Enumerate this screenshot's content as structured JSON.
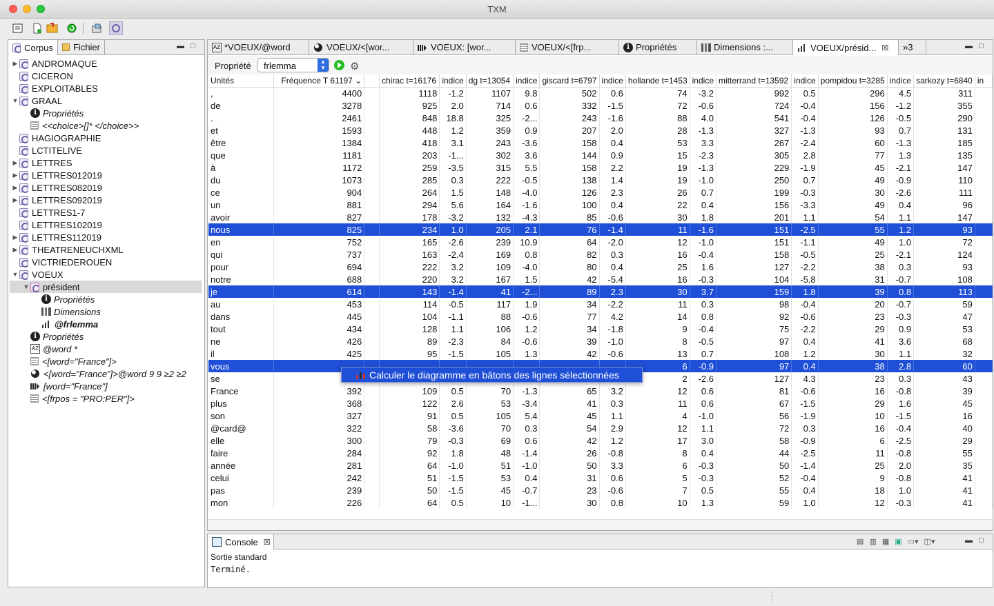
{
  "window": {
    "title": "TXM"
  },
  "colors": {
    "selection": "#1f4fd6",
    "tab_active": "#ffffff"
  },
  "left_panel": {
    "tabs": [
      {
        "label": "Corpus",
        "icon": "corpus-icon"
      },
      {
        "label": "Fichier",
        "icon": "folder-icon"
      }
    ],
    "tree": [
      {
        "label": "ANDROMAQUE",
        "depth": 0,
        "icon": "corpus",
        "expander": "closed"
      },
      {
        "label": "CICERON",
        "depth": 0,
        "icon": "corpus",
        "expander": "none"
      },
      {
        "label": "EXPLOITABLES",
        "depth": 0,
        "icon": "corpus",
        "expander": "none"
      },
      {
        "label": "GRAAL",
        "depth": 0,
        "icon": "corpus",
        "expander": "open"
      },
      {
        "label": "Propriétés",
        "depth": 1,
        "icon": "info",
        "expander": "none",
        "italic": true
      },
      {
        "label": "<<choice>[]* </choice>>",
        "depth": 1,
        "icon": "grid",
        "expander": "none",
        "italic": true
      },
      {
        "label": "HAGIOGRAPHIE",
        "depth": 0,
        "icon": "corpus",
        "expander": "none"
      },
      {
        "label": "LCTITELIVE",
        "depth": 0,
        "icon": "corpus",
        "expander": "none"
      },
      {
        "label": "LETTRES",
        "depth": 0,
        "icon": "corpus",
        "expander": "closed"
      },
      {
        "label": "LETTRES012019",
        "depth": 0,
        "icon": "corpus",
        "expander": "closed"
      },
      {
        "label": "LETTRES082019",
        "depth": 0,
        "icon": "corpus",
        "expander": "closed"
      },
      {
        "label": "LETTRES092019",
        "depth": 0,
        "icon": "corpus",
        "expander": "closed"
      },
      {
        "label": "LETTRES1-7",
        "depth": 0,
        "icon": "corpus",
        "expander": "none"
      },
      {
        "label": "LETTRES102019",
        "depth": 0,
        "icon": "corpus",
        "expander": "none"
      },
      {
        "label": "LETTRES112019",
        "depth": 0,
        "icon": "corpus",
        "expander": "closed"
      },
      {
        "label": "THEATRENEUCHXML",
        "depth": 0,
        "icon": "corpus",
        "expander": "closed"
      },
      {
        "label": "VICTRIEDEROUEN",
        "depth": 0,
        "icon": "corpus",
        "expander": "none"
      },
      {
        "label": "VOEUX",
        "depth": 0,
        "icon": "corpus",
        "expander": "open"
      },
      {
        "label": "président",
        "depth": 1,
        "icon": "partition",
        "expander": "open",
        "selected": true
      },
      {
        "label": "Propriétés",
        "depth": 2,
        "icon": "info",
        "expander": "none",
        "italic": true
      },
      {
        "label": "Dimensions",
        "depth": 2,
        "icon": "barchart",
        "expander": "none",
        "italic": true
      },
      {
        "label": "@frlemma",
        "depth": 2,
        "icon": "specif",
        "expander": "none",
        "italic": true,
        "bold": true
      },
      {
        "label": "Propriétés",
        "depth": 1,
        "icon": "info",
        "expander": "none",
        "italic": true
      },
      {
        "label": "@word *",
        "depth": 1,
        "icon": "az",
        "expander": "none",
        "italic": true
      },
      {
        "label": "<[word=\"France\"]>",
        "depth": 1,
        "icon": "grid",
        "expander": "none",
        "italic": true
      },
      {
        "label": "<[word=\"France\"]>@word 9 9 ≥2 ≥2",
        "depth": 1,
        "icon": "cooc",
        "expander": "none",
        "italic": true
      },
      {
        "label": "[word=\"France\"]",
        "depth": 1,
        "icon": "progression",
        "expander": "none",
        "italic": true
      },
      {
        "label": "<[frpos = \"PRO:PER\"]>",
        "depth": 1,
        "icon": "grid",
        "expander": "none",
        "italic": true
      }
    ]
  },
  "editor": {
    "tabs": [
      {
        "label": "*VOEUX/@word",
        "icon": "az"
      },
      {
        "label": "VOEUX/<[wor...",
        "icon": "cooc"
      },
      {
        "label": "VOEUX: [wor...",
        "icon": "progression"
      },
      {
        "label": "VOEUX/<[frp...",
        "icon": "grid"
      },
      {
        "label": "Propriétés",
        "icon": "info"
      },
      {
        "label": "Dimensions :...",
        "icon": "barchart"
      },
      {
        "label": "VOEUX/présid...",
        "icon": "specif",
        "active": true,
        "closable": true
      }
    ],
    "overflow_label": "»3",
    "property_label": "Propriété",
    "property_value": "frlemma",
    "columns": [
      "Unités",
      "Fréquence T 61197 ⌄",
      "chirac t=16176",
      "indice",
      "dg t=13054",
      "indice",
      "giscard t=6797",
      "indice",
      "hollande t=1453",
      "indice",
      "mitterrand t=13592",
      "indice",
      "pompidou t=3285",
      "indice",
      "sarkozy t=6840",
      "in"
    ],
    "rows": [
      [
        ",",
        "4400",
        "1118",
        "-1.2",
        "1107",
        "9.8",
        "502",
        "0.6",
        "74",
        "-3.2",
        "992",
        "0.5",
        "296",
        "4.5",
        "311"
      ],
      [
        "de",
        "3278",
        "925",
        "2.0",
        "714",
        "0.6",
        "332",
        "-1.5",
        "72",
        "-0.6",
        "724",
        "-0.4",
        "156",
        "-1.2",
        "355"
      ],
      [
        ".",
        "2461",
        "848",
        "18.8",
        "325",
        "-2...",
        "243",
        "-1.6",
        "88",
        "4.0",
        "541",
        "-0.4",
        "126",
        "-0.5",
        "290"
      ],
      [
        "et",
        "1593",
        "448",
        "1.2",
        "359",
        "0.9",
        "207",
        "2.0",
        "28",
        "-1.3",
        "327",
        "-1.3",
        "93",
        "0.7",
        "131"
      ],
      [
        "être",
        "1384",
        "418",
        "3.1",
        "243",
        "-3.6",
        "158",
        "0.4",
        "53",
        "3.3",
        "267",
        "-2.4",
        "60",
        "-1.3",
        "185"
      ],
      [
        "que",
        "1181",
        "203",
        "-1...",
        "302",
        "3.6",
        "144",
        "0.9",
        "15",
        "-2.3",
        "305",
        "2.8",
        "77",
        "1.3",
        "135"
      ],
      [
        "à",
        "1172",
        "259",
        "-3.5",
        "315",
        "5.5",
        "158",
        "2.2",
        "19",
        "-1.3",
        "229",
        "-1.9",
        "45",
        "-2.1",
        "147"
      ],
      [
        "du",
        "1073",
        "285",
        "0.3",
        "222",
        "-0.5",
        "138",
        "1.4",
        "19",
        "-1.0",
        "250",
        "0.7",
        "49",
        "-0.9",
        "110"
      ],
      [
        "ce",
        "904",
        "264",
        "1.5",
        "148",
        "-4.0",
        "126",
        "2.3",
        "26",
        "0.7",
        "199",
        "-0.3",
        "30",
        "-2.6",
        "111"
      ],
      [
        "un",
        "881",
        "294",
        "5.6",
        "164",
        "-1.6",
        "100",
        "0.4",
        "22",
        "0.4",
        "156",
        "-3.3",
        "49",
        "0.4",
        "96"
      ],
      [
        "avoir",
        "827",
        "178",
        "-3.2",
        "132",
        "-4.3",
        "85",
        "-0.6",
        "30",
        "1.8",
        "201",
        "1.1",
        "54",
        "1.1",
        "147"
      ],
      [
        "nous",
        "825",
        "234",
        "1.0",
        "205",
        "2.1",
        "76",
        "-1.4",
        "11",
        "-1.6",
        "151",
        "-2.5",
        "55",
        "1.2",
        "93"
      ],
      [
        "en",
        "752",
        "165",
        "-2.6",
        "239",
        "10.9",
        "64",
        "-2.0",
        "12",
        "-1.0",
        "151",
        "-1.1",
        "49",
        "1.0",
        "72"
      ],
      [
        "qui",
        "737",
        "163",
        "-2.4",
        "169",
        "0.8",
        "82",
        "0.3",
        "16",
        "-0.4",
        "158",
        "-0.5",
        "25",
        "-2.1",
        "124"
      ],
      [
        "pour",
        "694",
        "222",
        "3.2",
        "109",
        "-4.0",
        "80",
        "0.4",
        "25",
        "1.6",
        "127",
        "-2.2",
        "38",
        "0.3",
        "93"
      ],
      [
        "notre",
        "688",
        "220",
        "3.2",
        "167",
        "1.5",
        "42",
        "-5.4",
        "16",
        "-0.3",
        "104",
        "-5.8",
        "31",
        "-0.7",
        "108"
      ],
      [
        "je",
        "614",
        "143",
        "-1.4",
        "41",
        "-2...",
        "89",
        "2.3",
        "30",
        "3.7",
        "159",
        "1.8",
        "39",
        "0.8",
        "113"
      ],
      [
        "au",
        "453",
        "114",
        "-0.5",
        "117",
        "1.9",
        "34",
        "-2.2",
        "11",
        "0.3",
        "98",
        "-0.4",
        "20",
        "-0.7",
        "59"
      ],
      [
        "dans",
        "445",
        "104",
        "-1.1",
        "88",
        "-0.6",
        "77",
        "4.2",
        "14",
        "0.8",
        "92",
        "-0.6",
        "23",
        "-0.3",
        "47"
      ],
      [
        "tout",
        "434",
        "128",
        "1.1",
        "106",
        "1.2",
        "34",
        "-1.8",
        "9",
        "-0.4",
        "75",
        "-2.2",
        "29",
        "0.9",
        "53"
      ],
      [
        "ne",
        "426",
        "89",
        "-2.3",
        "84",
        "-0.6",
        "39",
        "-1.0",
        "8",
        "-0.5",
        "97",
        "0.4",
        "41",
        "3.6",
        "68"
      ],
      [
        "il",
        "425",
        "95",
        "-1.5",
        "105",
        "1.3",
        "42",
        "-0.6",
        "13",
        "0.7",
        "108",
        "1.2",
        "30",
        "1.1",
        "32"
      ],
      [
        "vous",
        "",
        "",
        "",
        "",
        "",
        "",
        "",
        "6",
        "-0.9",
        "97",
        "0.4",
        "38",
        "2.8",
        "60"
      ],
      [
        "se",
        "",
        "",
        "",
        "",
        "",
        "",
        "",
        "2",
        "-2.6",
        "127",
        "4.3",
        "23",
        "0.3",
        "43"
      ],
      [
        "France",
        "392",
        "109",
        "0.5",
        "70",
        "-1.3",
        "65",
        "3.2",
        "12",
        "0.6",
        "81",
        "-0.6",
        "16",
        "-0.8",
        "39"
      ],
      [
        "plus",
        "368",
        "122",
        "2.6",
        "53",
        "-3.4",
        "41",
        "0.3",
        "11",
        "0.6",
        "67",
        "-1.5",
        "29",
        "1.6",
        "45"
      ],
      [
        "son",
        "327",
        "91",
        "0.5",
        "105",
        "5.4",
        "45",
        "1.1",
        "4",
        "-1.0",
        "56",
        "-1.9",
        "10",
        "-1.5",
        "16"
      ],
      [
        "@card@",
        "322",
        "58",
        "-3.6",
        "70",
        "0.3",
        "54",
        "2.9",
        "12",
        "1.1",
        "72",
        "0.3",
        "16",
        "-0.4",
        "40"
      ],
      [
        "elle",
        "300",
        "79",
        "-0.3",
        "69",
        "0.6",
        "42",
        "1.2",
        "17",
        "3.0",
        "58",
        "-0.9",
        "6",
        "-2.5",
        "29"
      ],
      [
        "faire",
        "284",
        "92",
        "1.8",
        "48",
        "-1.4",
        "26",
        "-0.8",
        "8",
        "0.4",
        "44",
        "-2.5",
        "11",
        "-0.8",
        "55"
      ],
      [
        "année",
        "281",
        "64",
        "-1.0",
        "51",
        "-1.0",
        "50",
        "3.3",
        "6",
        "-0.3",
        "50",
        "-1.4",
        "25",
        "2.0",
        "35"
      ],
      [
        "celui",
        "242",
        "51",
        "-1.5",
        "53",
        "0.4",
        "31",
        "0.6",
        "5",
        "-0.3",
        "52",
        "-0.4",
        "9",
        "-0.8",
        "41"
      ],
      [
        "pas",
        "239",
        "50",
        "-1.5",
        "45",
        "-0.7",
        "23",
        "-0.6",
        "7",
        "0.5",
        "55",
        "0.4",
        "18",
        "1.0",
        "41"
      ],
      [
        "mon",
        "226",
        "64",
        "0.5",
        "10",
        "-1...",
        "30",
        "0.8",
        "10",
        "1.3",
        "59",
        "1.0",
        "12",
        "-0.3",
        "41"
      ]
    ],
    "selected_rows": [
      "nous",
      "je",
      "vous"
    ],
    "context_menu": {
      "label": "Calculer le diagramme en bâtons des lignes sélectionnées"
    }
  },
  "console": {
    "tab_label": "Console",
    "stream_label": "Sortie standard",
    "output": "Terminé."
  }
}
